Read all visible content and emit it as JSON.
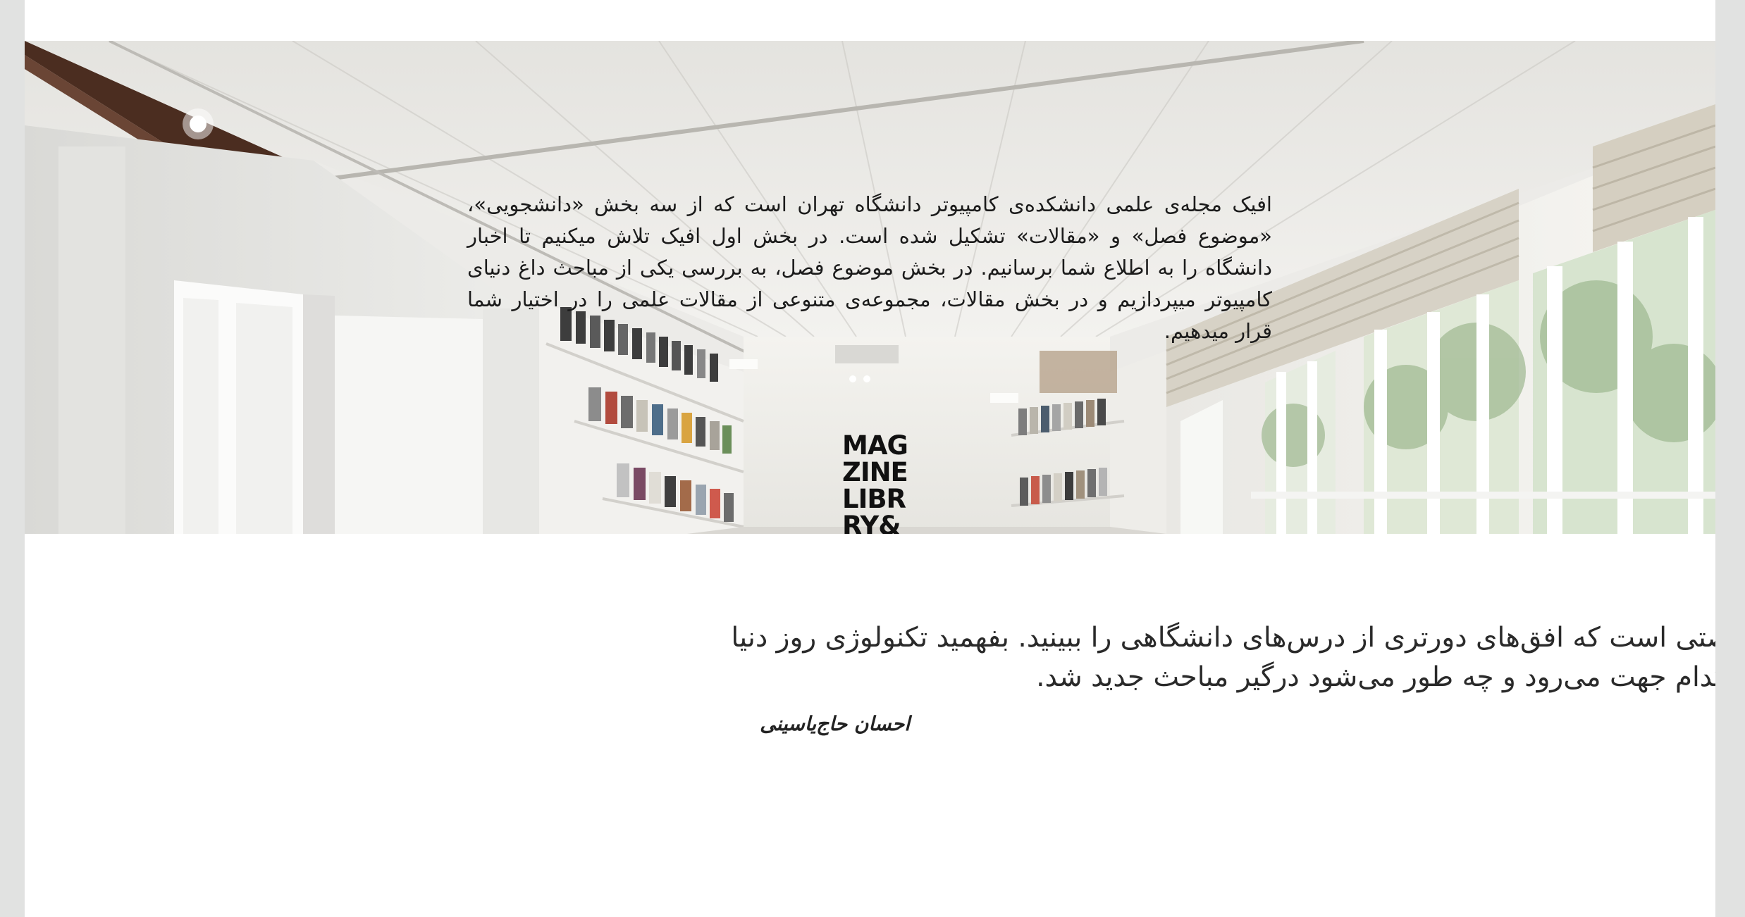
{
  "hero": {
    "intro_text": "افیک مجله‌ی علمی دانشکده‌ی کامپیوتر دانشگاه تهران است که از سه بخش «دانشجویی»، «موضوع فصل» و «مقالات» تشکیل شده است. در بخش اول افیک تلاش میکنیم تا اخبار دانشگاه را به اطلاع شما برسانیم. در بخش موضوع فصل، به بررسی یکی از مباحث داغ دنیای کامپیوتر میپردازیم و در بخش مقالات، مجموعه‌ی متنوعی از مقالات علمی را در اختیار شما قرار میدهیم.",
    "wall_sign_lines": [
      "MAG",
      "ZINE",
      "LIBR",
      "RY&"
    ]
  },
  "quote": {
    "line1": "فرصتی است که افق‌های دورتری از درس‌های دانشگاهی را ببینید. بفهمید تکنولوژی روز دنیا",
    "line2": "به کدام جهت می‌رود و چه طور می‌شود درگیر مباحث جدید شد.",
    "author": "احسان حاج‌یاسینی"
  },
  "colors": {
    "page_background": "#e1e2e1",
    "content_background": "#ffffff",
    "text": "#1b1b1b"
  }
}
